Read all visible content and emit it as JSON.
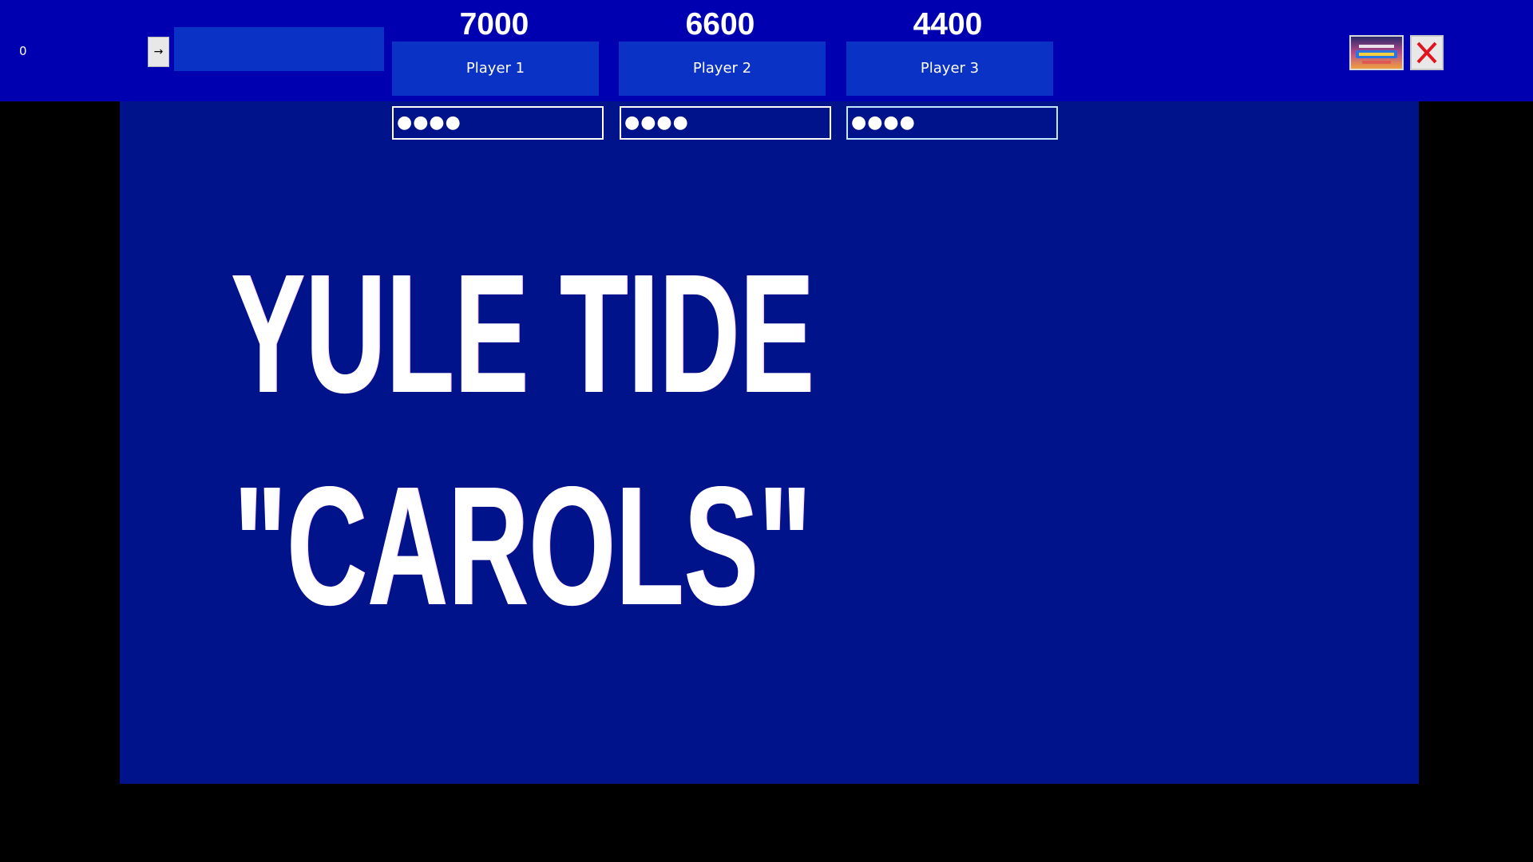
{
  "topbar": {
    "counter": "0",
    "advance_icon": "arrow-right-icon",
    "advance_glyph": "→",
    "final_jeopardy_icon": "final-jeopardy-logo-icon",
    "close_icon": "close-icon"
  },
  "players": [
    {
      "name": "Player 1",
      "score": "7000",
      "password": "●●●●"
    },
    {
      "name": "Player 2",
      "score": "6600",
      "password": "●●●●"
    },
    {
      "name": "Player 3",
      "score": "4400",
      "password": "●●●●"
    }
  ],
  "board": {
    "category_line1": "YULE TIDE",
    "category_line2": "\"CAROLS\""
  },
  "colors": {
    "topbar": "#0000b0",
    "tile": "#0a32c4",
    "board": "#00138a",
    "background": "#000000",
    "text": "#ffffff",
    "close_x": "#e0141e"
  }
}
